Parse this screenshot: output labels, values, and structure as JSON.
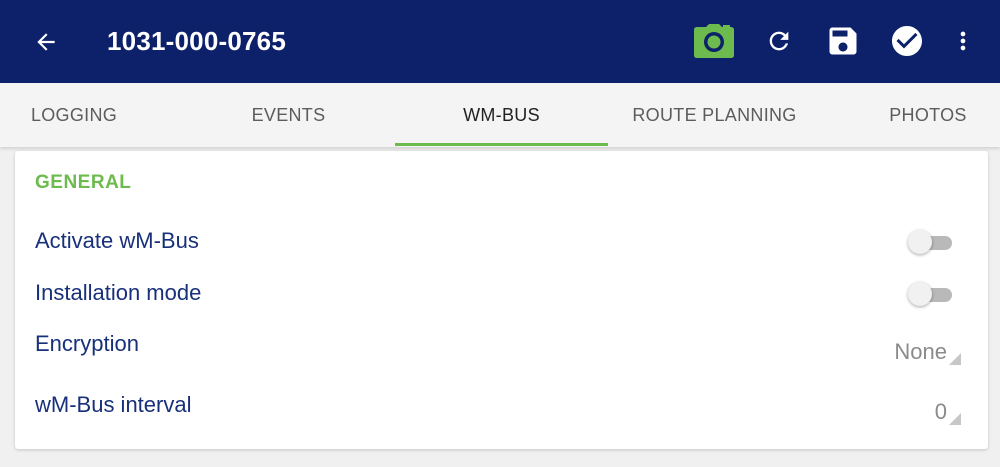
{
  "appbar": {
    "title": "1031-000-0765",
    "colors": {
      "background": "#0c2169",
      "icon": "#ffffff",
      "camera": "#6dbb4e"
    },
    "icons": [
      "arrow-back-icon",
      "camera-icon",
      "refresh-icon",
      "save-icon",
      "check-circle-icon",
      "more-vert-icon"
    ]
  },
  "tabs": [
    {
      "label": "LOGGING"
    },
    {
      "label": "EVENTS"
    },
    {
      "label": "WM-BUS",
      "active": true
    },
    {
      "label": "ROUTE PLANNING"
    },
    {
      "label": "PHOTOS"
    }
  ],
  "general": {
    "title": "GENERAL",
    "activate_label": "Activate wM-Bus",
    "activate_on": false,
    "installation_label": "Installation mode",
    "installation_on": false,
    "encryption_label": "Encryption",
    "encryption_value": "None",
    "interval_label": "wM-Bus interval",
    "interval_value": "0"
  },
  "colors": {
    "accent": "#6dbb4e",
    "label_text": "#18307a",
    "value_text": "#8a8a8a"
  }
}
